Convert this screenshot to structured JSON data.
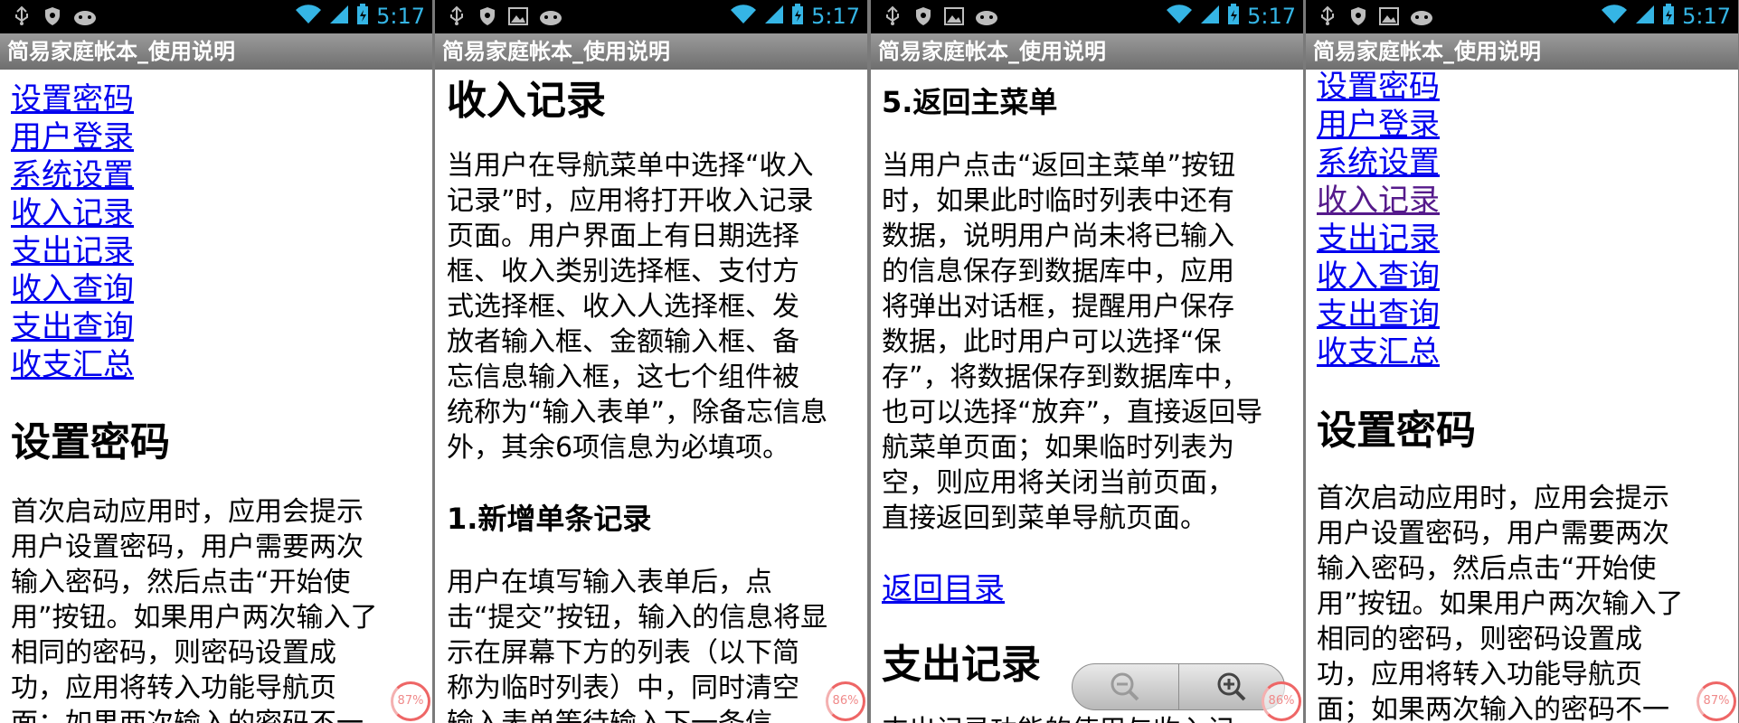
{
  "status": {
    "time": "5:17"
  },
  "app_title": "简易家庭帐本_使用说明",
  "toc": {
    "items": [
      "设置密码",
      "用户登录",
      "系统设置",
      "收入记录",
      "支出记录",
      "收入查询",
      "支出查询",
      "收支汇总"
    ]
  },
  "sections": {
    "set_password": {
      "heading": "设置密码",
      "body_lines_panel1": [
        "首次启动应用时，应用会提示",
        "用户设置密码，用户需要两次",
        "输入密码，然后点击“开始使",
        "用”按钮。如果用户两次输入了",
        "相同的密码，则密码设置成",
        "功，应用将转入功能导航页",
        "面；如果两次输入的密码不一"
      ],
      "body_lines_panel4": [
        "首次启动应用时，应用会提示",
        "用户设置密码，用户需要两次",
        "输入密码，然后点击“开始使",
        "用”按钮。如果用户两次输入了",
        "相同的密码，则密码设置成",
        "功，应用将转入功能导航页",
        "面；如果两次输入的密码不一"
      ]
    },
    "income": {
      "heading": "收入记录",
      "intro_lines": [
        "当用户在导航菜单中选择“收入",
        "记录”时，应用将打开收入记录",
        "页面。用户界面上有日期选择",
        "框、收入类别选择框、支付方",
        "式选择框、收入人选择框、发",
        "放者输入框、金额输入框、备",
        "忘信息输入框，这七个组件被",
        "统称为“输入表单”，除备忘信息",
        "外，其余6项信息为必填项。"
      ],
      "sub1_heading": "1.新增单条记录",
      "sub1_lines": [
        "用户在填写输入表单后，点",
        "击“提交”按钮，输入的信息将显",
        "示在屏幕下方的列表（以下简",
        "称为临时列表）中，同时清空",
        "输入表单等待输入下一条信"
      ]
    },
    "back_menu": {
      "heading": "5.返回主菜单",
      "lines": [
        "当用户点击“返回主菜单”按钮",
        "时，如果此时临时列表中还有",
        "数据，说明用户尚未将已输入",
        "的信息保存到数据库中，应用",
        "将弹出对话框，提醒用户保存",
        "数据，此时用户可以选择“保",
        "存”，将数据保存到数据库中，",
        "也可以选择“放弃”，直接返回导",
        "航菜单页面；如果临时列表为",
        "空，则应用将关闭当前页面，",
        "直接返回到菜单导航页面。"
      ],
      "back_link": "返回目录",
      "next_heading": "支出记录",
      "next_partial": "支出记录功能的使用与收入记"
    }
  },
  "zoom_indicators": [
    "87%",
    "86%",
    "86%",
    "87%"
  ],
  "icons": {
    "status_left": [
      "usb-icon",
      "shield-icon",
      "image-icon",
      "android-icon"
    ],
    "status_right": [
      "wifi-icon",
      "signal-icon",
      "battery-icon"
    ]
  },
  "colors": {
    "link": "#0000ee",
    "visited": "#551a8b",
    "status_accent": "#35b5e5"
  }
}
